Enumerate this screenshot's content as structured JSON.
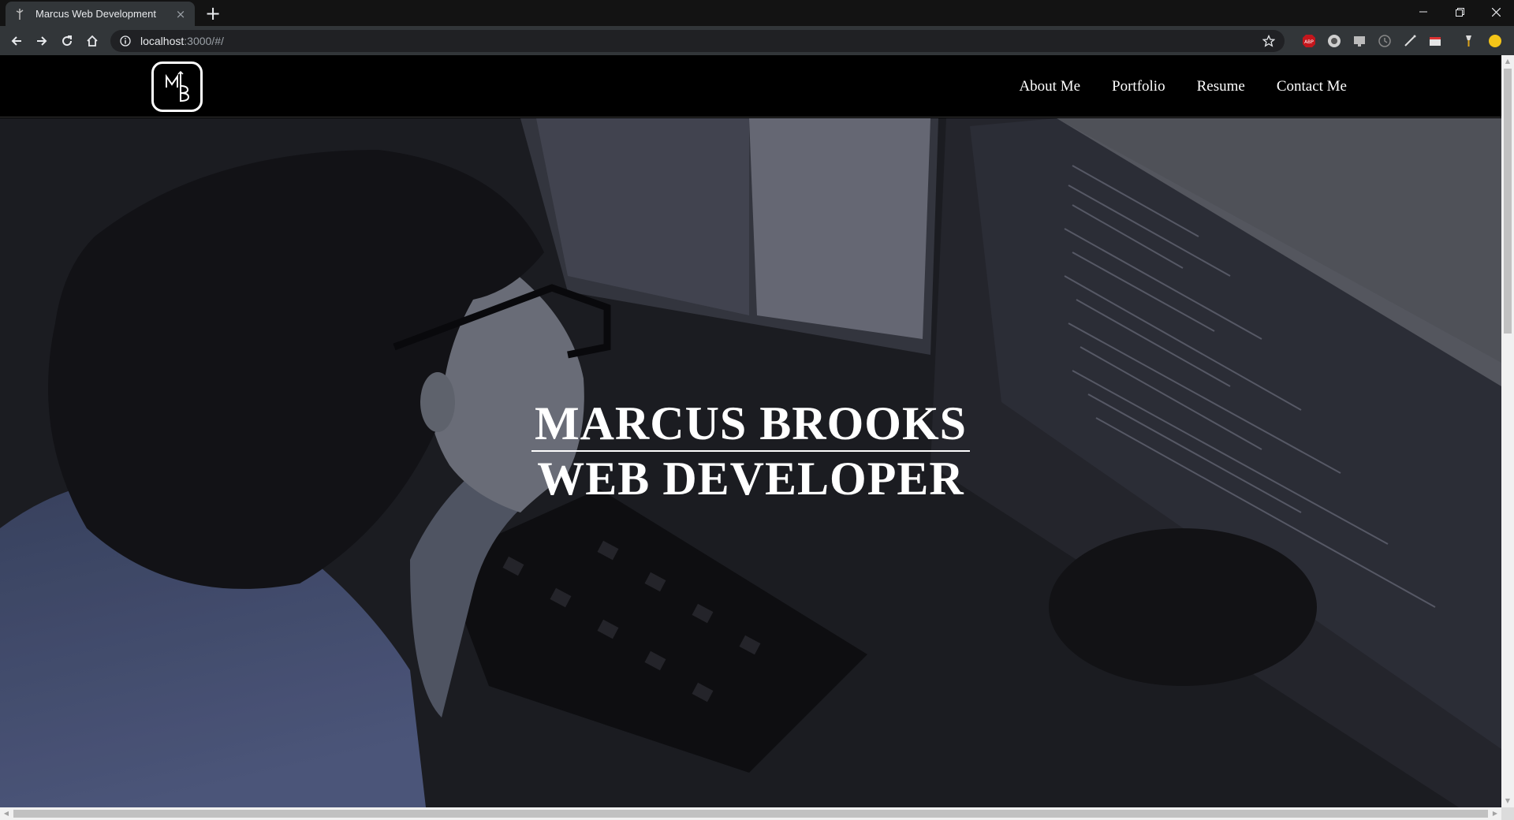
{
  "browser": {
    "tab_title": "Marcus Web Development",
    "tab_close": "×",
    "new_tab": "+",
    "url_host": "localhost",
    "url_rest": ":3000/#/"
  },
  "site": {
    "logo_text": "MB",
    "nav": [
      "About Me",
      "Portfolio",
      "Resume",
      "Contact Me"
    ]
  },
  "hero": {
    "line1": "MARCUS BROOKS",
    "line2": "WEB DEVELOPER"
  },
  "icons": {
    "back": "arrow-left-icon",
    "forward": "arrow-right-icon",
    "reload": "reload-icon",
    "home": "home-icon",
    "info": "info-icon",
    "star": "star-icon"
  },
  "colors": {
    "chrome_dark": "#131313",
    "toolbar": "#323639",
    "omnibox": "#202124",
    "page_bg": "#000000",
    "hero_text": "#ffffff"
  }
}
